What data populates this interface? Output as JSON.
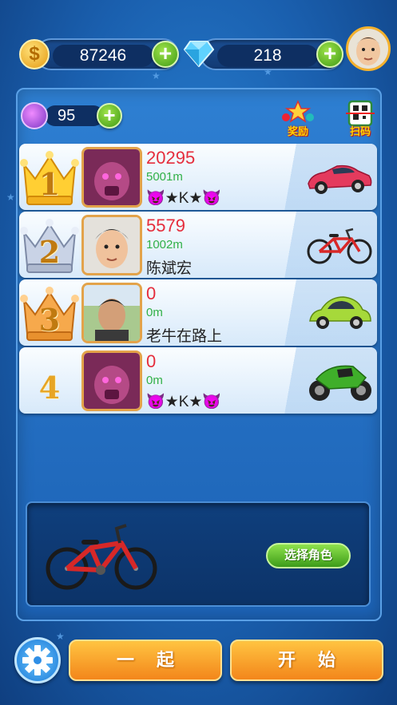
{
  "header": {
    "coins": "87246",
    "gems": "218",
    "coin_icon": "dollar-coin-icon",
    "gem_icon": "diamond-icon"
  },
  "panel": {
    "potion_count": "95",
    "reward_label": "奖励",
    "scan_label": "扫码"
  },
  "leaderboard": [
    {
      "rank": "1",
      "score": "20295",
      "distance": "5001m",
      "name": "😈★K★😈",
      "vehicle": "sports-car-icon"
    },
    {
      "rank": "2",
      "score": "5579",
      "distance": "1002m",
      "name": "陈斌宏",
      "vehicle": "bicycle-icon"
    },
    {
      "rank": "3",
      "score": "0",
      "distance": "0m",
      "name": "老牛在路上",
      "vehicle": "beetle-car-icon"
    },
    {
      "rank": "4",
      "score": "0",
      "distance": "0m",
      "name": "😈★K★😈",
      "vehicle": "motorcycle-icon"
    }
  ],
  "selection": {
    "choose_label": "选择角色"
  },
  "footer": {
    "together_label": "一起",
    "start_label": "开始"
  },
  "colors": {
    "score": "#e52d3c",
    "distance": "#31b047",
    "accent_green": "#3d9c19",
    "accent_orange": "#f3861b"
  }
}
